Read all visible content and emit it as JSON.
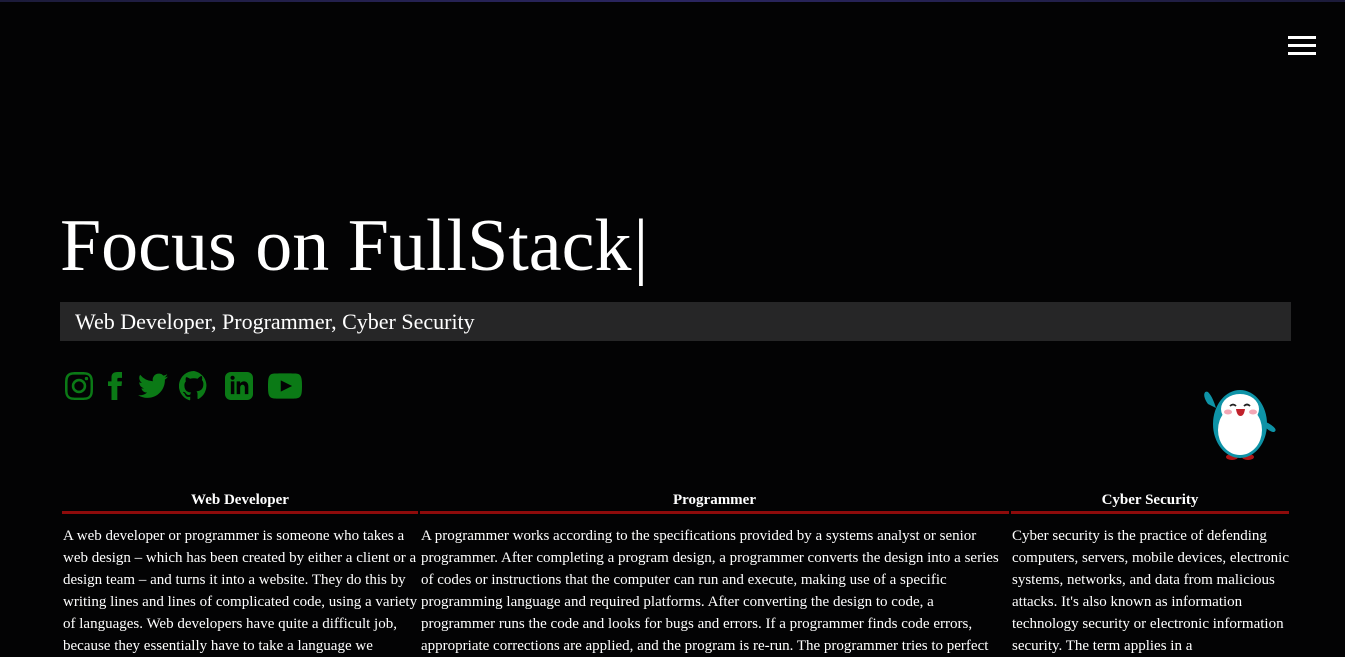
{
  "header": {
    "menu_icon": "hamburger-menu-icon"
  },
  "hero": {
    "title": "Focus on FullStack",
    "cursor": "|",
    "subtitle": "Web Developer, Programmer, Cyber Security"
  },
  "socials": [
    {
      "icon": "instagram-icon"
    },
    {
      "icon": "facebook-icon"
    },
    {
      "icon": "twitter-icon"
    },
    {
      "icon": "github-icon"
    },
    {
      "icon": "linkedin-icon"
    },
    {
      "icon": "youtube-icon"
    }
  ],
  "colors": {
    "background": "#030304",
    "social_green": "#0b7a16",
    "heading_underline": "#8e0b0b",
    "subtitle_bar": "#262627"
  },
  "mascot": {
    "icon": "penguin-waving-icon"
  },
  "columns": [
    {
      "heading": "Web Developer",
      "body": "A web developer or programmer is someone who takes a web design – which has been created by either a client or a design team – and turns it into a website. They do this by writing lines and lines of complicated code, using a variety of languages. Web developers have quite a difficult job, because they essentially have to take a language we"
    },
    {
      "heading": "Programmer",
      "body": "A programmer works according to the specifications provided by a systems analyst or senior programmer. After completing a program design, a programmer converts the design into a series of codes or instructions that the computer can run and execute, making use of a specific programming language and required platforms. After converting the design to code, a programmer runs the code and looks for bugs and errors. If a programmer finds code errors, appropriate corrections are applied, and the program is re-run. The programmer tries to perfect"
    },
    {
      "heading": "Cyber Security",
      "body": "Cyber security is the practice of defending computers, servers, mobile devices, electronic systems, networks, and data from malicious attacks. It's also known as information technology security or electronic information security. The term applies in a"
    }
  ]
}
